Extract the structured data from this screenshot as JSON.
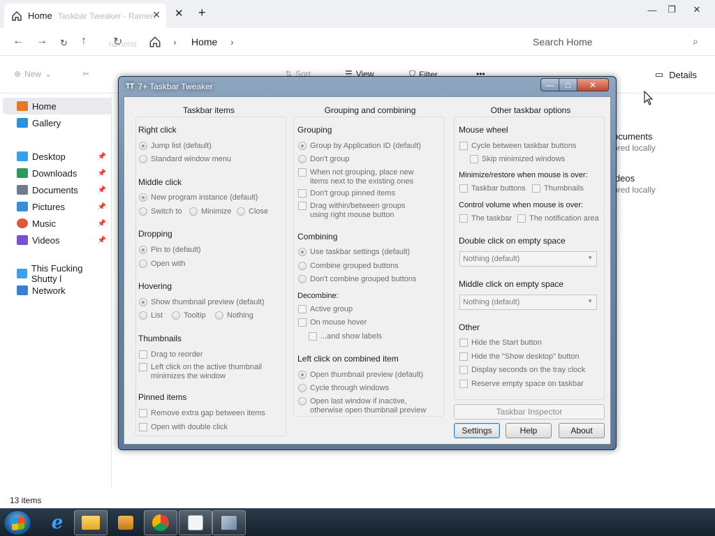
{
  "explorer": {
    "tab_title": "Home",
    "tab_ghost": "Taskbar Tweaker - Ramen",
    "search_placeholder": "Search Home",
    "breadcrumb": [
      "Home"
    ],
    "ghost_path": "ramens",
    "toolbar": {
      "new": "New",
      "sort": "Sort",
      "view": "View",
      "filter": "Filter",
      "more": "•••",
      "details": "Details"
    },
    "sidebar": [
      {
        "label": "Home",
        "icon": "home-icon",
        "color": "#e07a2b"
      },
      {
        "label": "Gallery",
        "icon": "gallery-icon",
        "color": "#2f8fd8"
      },
      {
        "label": "Desktop",
        "icon": "desktop-icon",
        "color": "#3aa0e8",
        "pinned": true
      },
      {
        "label": "Downloads",
        "icon": "download-icon",
        "color": "#2e9a5e",
        "pinned": true
      },
      {
        "label": "Documents",
        "icon": "documents-icon",
        "color": "#6d7d8e",
        "pinned": true
      },
      {
        "label": "Pictures",
        "icon": "pictures-icon",
        "color": "#3b8ed6",
        "pinned": true
      },
      {
        "label": "Music",
        "icon": "music-icon",
        "color": "#e0573b",
        "pinned": true
      },
      {
        "label": "Videos",
        "icon": "videos-icon",
        "color": "#7c4fd1",
        "pinned": true
      },
      {
        "label": "This Fucking Shutty l",
        "icon": "computer-icon",
        "color": "#3aa0e8"
      },
      {
        "label": "Network",
        "icon": "network-icon",
        "color": "#3a7fd0"
      }
    ],
    "cards": [
      {
        "title": "ocuments",
        "sub": "ored locally"
      },
      {
        "title": "ideos",
        "sub": "ored locally"
      }
    ],
    "status": "13 items"
  },
  "dialog": {
    "title": "7+ Taskbar Tweaker",
    "icon_text": "TT",
    "col1": {
      "heading": "Taskbar items",
      "right_click": {
        "label": "Right click",
        "options": [
          "Jump list (default)",
          "Standard window menu"
        ]
      },
      "middle_click": {
        "label": "Middle click",
        "options": [
          "New program instance (default)",
          "Switch to",
          "Minimize",
          "Close"
        ]
      },
      "dropping": {
        "label": "Dropping",
        "options": [
          "Pin to (default)",
          "Open with"
        ]
      },
      "hovering": {
        "label": "Hovering",
        "options": [
          "Show thumbnail preview (default)",
          "List",
          "Tooltip",
          "Nothing"
        ]
      },
      "thumbnails": {
        "label": "Thumbnails",
        "options": [
          "Drag to reorder",
          "Left click on the active thumbnail",
          "minimizes the window"
        ]
      },
      "pinned": {
        "label": "Pinned items",
        "options": [
          "Remove extra gap between items",
          "Open with double click"
        ]
      }
    },
    "col2": {
      "heading": "Grouping and combining",
      "grouping": {
        "label": "Grouping",
        "options": [
          "Group by Application ID (default)",
          "Don't group",
          "When not grouping, place new",
          "items next to the existing ones",
          "Don't group pinned items",
          "Drag within/between groups",
          "using right mouse button"
        ]
      },
      "combining": {
        "label": "Combining",
        "options": [
          "Use taskbar settings (default)",
          "Combine grouped buttons",
          "Don't combine grouped buttons"
        ]
      },
      "decombine": {
        "label": "Decombine:",
        "options": [
          "Active group",
          "On mouse hover",
          "...and show labels"
        ]
      },
      "left_click": {
        "label": "Left click on combined item",
        "options": [
          "Open thumbnail preview (default)",
          "Cycle through windows",
          "Open last window if inactive,",
          "otherwise open thumbnail preview"
        ]
      }
    },
    "col3": {
      "heading": "Other taskbar options",
      "mouse_wheel": {
        "label": "Mouse wheel",
        "options": [
          "Cycle between taskbar buttons",
          "Skip minimized windows"
        ]
      },
      "minimize_restore": {
        "label": "Minimize/restore when mouse is over:",
        "options": [
          "Taskbar buttons",
          "Thumbnails"
        ]
      },
      "control_volume": {
        "label": "Control volume when mouse is over:",
        "options": [
          "The taskbar",
          "The notification area"
        ]
      },
      "double_click": {
        "label": "Double click on empty space",
        "value": "Nothing (default)"
      },
      "middle_click_empty": {
        "label": "Middle click on empty space",
        "value": "Nothing (default)"
      },
      "other": {
        "label": "Other",
        "options": [
          "Hide the Start button",
          "Hide the \"Show desktop\" button",
          "Display seconds on the tray clock",
          "Reserve empty space on taskbar"
        ]
      }
    },
    "buttons": {
      "inspector": "Taskbar Inspector",
      "settings": "Settings",
      "help": "Help",
      "about": "About"
    }
  },
  "taskbar": {
    "items": [
      "start-orb",
      "internet-explorer-icon",
      "file-explorer-icon",
      "media-player-icon",
      "chrome-icon",
      "calendar-app-icon",
      "taskbar-tweaker-icon"
    ]
  }
}
